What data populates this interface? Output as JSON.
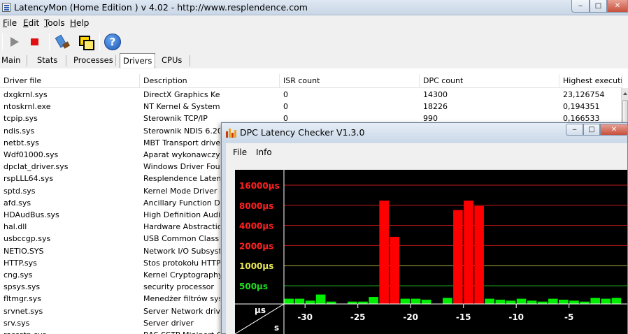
{
  "main_window": {
    "title": "LatencyMon  (Home Edition )  v 4.02 - http://www.resplendence.com",
    "menu": [
      {
        "label": "File",
        "key": "F",
        "rest": "ile"
      },
      {
        "label": "Edit",
        "key": "E",
        "rest": "dit"
      },
      {
        "label": "Tools",
        "key": "T",
        "rest": "ools"
      },
      {
        "label": "Help",
        "key": "H",
        "rest": "elp"
      }
    ],
    "toolbar_icons": [
      "play-icon",
      "stop-icon",
      "brush-icon",
      "windows-icon",
      "help-icon"
    ],
    "help_glyph": "?",
    "tabs": [
      "Main",
      "Stats",
      "Processes",
      "Drivers",
      "CPUs"
    ],
    "active_tab": "Drivers",
    "columns": [
      "Driver file",
      "Description",
      "ISR count",
      "DPC count",
      "Highest execution"
    ],
    "rows": [
      [
        "dxgkrnl.sys",
        "DirectX Graphics Kernel",
        "0",
        "14300",
        "23,126754"
      ],
      [
        "ntoskrnl.exe",
        "NT Kernel & System",
        "0",
        "18226",
        "0,194351"
      ],
      [
        "tcpip.sys",
        "Sterownik TCP/IP",
        "0",
        "990",
        "0,166533"
      ],
      [
        "ndis.sys",
        "Sterownik NDIS 6.20",
        "",
        "",
        ""
      ],
      [
        "netbt.sys",
        "MBT Transport driver",
        "",
        "",
        ""
      ],
      [
        "Wdf01000.sys",
        "Aparat wykonawczy st",
        "",
        "",
        ""
      ],
      [
        "dpclat_driver.sys",
        "Windows Driver Founda",
        "",
        "",
        ""
      ],
      [
        "rspLLL64.sys",
        "Resplendence Latency",
        "",
        "",
        ""
      ],
      [
        "sptd.sys",
        "Kernel Mode Driver Fra",
        "",
        "",
        ""
      ],
      [
        "afd.sys",
        "Ancillary Function Drive",
        "",
        "",
        ""
      ],
      [
        "HDAudBus.sys",
        "High Definition Audio Bu",
        "",
        "",
        ""
      ],
      [
        "hal.dll",
        "Hardware Abstraction I",
        "",
        "",
        ""
      ],
      [
        "usbccgp.sys",
        "USB Common Class Ger",
        "",
        "",
        ""
      ],
      [
        "NETIO.SYS",
        "Network I/O Subsyster",
        "",
        "",
        ""
      ],
      [
        "HTTP.sys",
        "Stos protokołu HTTP",
        "",
        "",
        ""
      ],
      [
        "cng.sys",
        "Kernel Cryptography, N",
        "",
        "",
        ""
      ],
      [
        "spsys.sys",
        "security processor",
        "",
        "",
        ""
      ],
      [
        "fltmgr.sys",
        "Menedżer filtrów syste",
        "",
        "",
        ""
      ],
      [
        "srvnet.sys",
        "Server Network driver",
        "",
        "",
        ""
      ],
      [
        "srv.sys",
        "Server driver",
        "",
        "",
        ""
      ],
      [
        "rassstp.sys",
        "RAS SSTP Miniport Call",
        "",
        "",
        ""
      ]
    ],
    "window_buttons": {
      "minimize": "‒",
      "maximize": "□",
      "close": "✕"
    }
  },
  "dpc_window": {
    "title": "DPC Latency Checker V1.3.0",
    "menu": [
      "File",
      "Info"
    ],
    "window_buttons": {
      "minimize": "‒",
      "maximize": "□",
      "close": "✕"
    }
  },
  "chart_data": {
    "type": "bar",
    "title": "",
    "xlabel": "s",
    "ylabel": "µs",
    "y_scale": "log",
    "y_levels": [
      {
        "label": "16000µs",
        "value": 16000,
        "color": "#ff2020"
      },
      {
        "label": "8000µs",
        "value": 8000,
        "color": "#ff2020"
      },
      {
        "label": "4000µs",
        "value": 4000,
        "color": "#ff2020"
      },
      {
        "label": "2000µs",
        "value": 2000,
        "color": "#ff2020"
      },
      {
        "label": "1000µs",
        "value": 1000,
        "color": "#e8e85a"
      },
      {
        "label": "500µs",
        "value": 500,
        "color": "#22dd22"
      }
    ],
    "x_ticks": [
      -30,
      -25,
      -20,
      -15,
      -10,
      -5
    ],
    "x_range": [
      -32.5,
      0
    ],
    "grid": true,
    "background": "#000000",
    "colors": {
      "normal": "#00ee00",
      "warning": "#ffff00",
      "critical": "#ff0000"
    },
    "bars": [
      {
        "x": -32,
        "value": 320
      },
      {
        "x": -31,
        "value": 320
      },
      {
        "x": -30,
        "value": 300
      },
      {
        "x": -29,
        "value": 370
      },
      {
        "x": -28,
        "value": 290
      },
      {
        "x": -27,
        "value": 270
      },
      {
        "x": -26,
        "value": 290
      },
      {
        "x": -25,
        "value": 290
      },
      {
        "x": -24,
        "value": 340
      },
      {
        "x": -23,
        "value": 9400
      },
      {
        "x": -22,
        "value": 2700
      },
      {
        "x": -21,
        "value": 320
      },
      {
        "x": -20,
        "value": 320
      },
      {
        "x": -19,
        "value": 310
      },
      {
        "x": -18,
        "value": 270
      },
      {
        "x": -17,
        "value": 330
      },
      {
        "x": -16,
        "value": 6800
      },
      {
        "x": -15,
        "value": 9400
      },
      {
        "x": -14,
        "value": 7800
      },
      {
        "x": -13,
        "value": 320
      },
      {
        "x": -12,
        "value": 310
      },
      {
        "x": -11,
        "value": 300
      },
      {
        "x": -10,
        "value": 320
      },
      {
        "x": -9,
        "value": 300
      },
      {
        "x": -8,
        "value": 290
      },
      {
        "x": -7,
        "value": 320
      },
      {
        "x": -6,
        "value": 310
      },
      {
        "x": -5,
        "value": 300
      },
      {
        "x": -4,
        "value": 290
      },
      {
        "x": -3,
        "value": 330
      },
      {
        "x": -2,
        "value": 320
      },
      {
        "x": -1,
        "value": 330
      }
    ]
  }
}
